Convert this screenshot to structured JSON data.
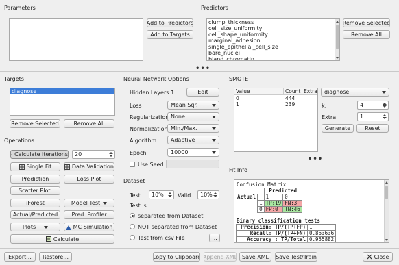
{
  "parameters": {
    "title": "Parameters",
    "add_to_predictors": "Add to Predictors",
    "add_to_targets": "Add to Targets"
  },
  "predictors": {
    "title": "Predictors",
    "items": [
      "clump_thickness",
      "cell_size_uniformity",
      "cell_shape_uniformity",
      "marginal_adhesion",
      "single_epithelial_cell_size",
      "bare_nuclei",
      "bland_chromatin"
    ],
    "remove_selected": "Remove Selected",
    "remove_all": "Remove All"
  },
  "targets": {
    "title": "Targets",
    "items": [
      "diagnose"
    ],
    "remove_selected": "Remove Selected",
    "remove_all": "Remove All"
  },
  "operations": {
    "title": "Operations",
    "calculate_iterations": "Calculate iterations",
    "iterations_value": "20",
    "single_fit": "Single Fit",
    "data_validation": "Data Validation",
    "prediction": "Prediction",
    "loss_plot": "Loss Plot",
    "scatter_plot": "Scatter Plot.",
    "iforest": "iForest",
    "model_test": "Model Test",
    "actual_predicted": "Actual/Predicted",
    "pred_profiler": "Pred. Profiler",
    "plots": "Plots",
    "mc_simulation": "MC Simulation",
    "calculate": "Calculate"
  },
  "nn": {
    "title": "Neural Network Options",
    "hidden_layers_label": "Hidden Layers:1",
    "edit": "Edit",
    "loss_label": "Loss",
    "loss_value": "Mean Sqr.",
    "regularization_label": "Regularization",
    "regularization_value": "None",
    "normalization_label": "Normalization",
    "normalization_value": "Min./Max.",
    "algorithm_label": "Algorithm",
    "algorithm_value": "Adaptive",
    "epoch_label": "Epoch",
    "epoch_value": "10000",
    "use_seed_label": "Use Seed"
  },
  "dataset": {
    "title": "Dataset",
    "test_label": "Test",
    "test_value": "10%",
    "valid_label": "Valid.",
    "valid_value": "10%",
    "test_is_label": "Test is :",
    "opt_separated": "separated from Dataset",
    "opt_not_separated": "NOT separated from Dataset",
    "opt_csv": "Test from csv File",
    "browse": "..."
  },
  "smote": {
    "title": "SMOTE",
    "columns": [
      "Value",
      "Count",
      "Extra"
    ],
    "rows": [
      [
        "0",
        "444",
        ""
      ],
      [
        "1",
        "239",
        ""
      ]
    ],
    "target_value": "diagnose",
    "k_label": "k:",
    "k_value": "4",
    "extra_label": "Extra:",
    "extra_value": "1",
    "generate": "Generate",
    "reset": "Reset"
  },
  "fit_info": {
    "title": "Fit Info",
    "cm_title": "Confusion Matrix",
    "predicted": "Predicted",
    "actual": "Actual",
    "one": "1",
    "zero": "0",
    "tp": "TP:19",
    "fn": "FN:3",
    "fp": "FP:0",
    "tn": "TN:46",
    "binary_title": "Binary classification tests",
    "precision_label": "Precision: TP/(TP+FP)",
    "precision_value": "1",
    "recall_label": "Recall: TP/(TP+FN)",
    "recall_value": "0.863636",
    "accuracy_label": "Accuracy : TP/Total",
    "accuracy_value": "0.955882"
  },
  "bottom": {
    "export": "Export...",
    "restore": "Restore...",
    "copy_clipboard": "Copy to Clipboard",
    "append_xml": "Append XML",
    "save_xml": "Save XML",
    "save_test_train": "Save Test/Train",
    "close": "Close"
  },
  "colors": {
    "tp_bg": "#a8e6a0",
    "fn_bg": "#f4a6a6",
    "fp_bg": "#f4a6a6",
    "tn_bg": "#a8e6a0",
    "selection": "#3d7dd8"
  }
}
